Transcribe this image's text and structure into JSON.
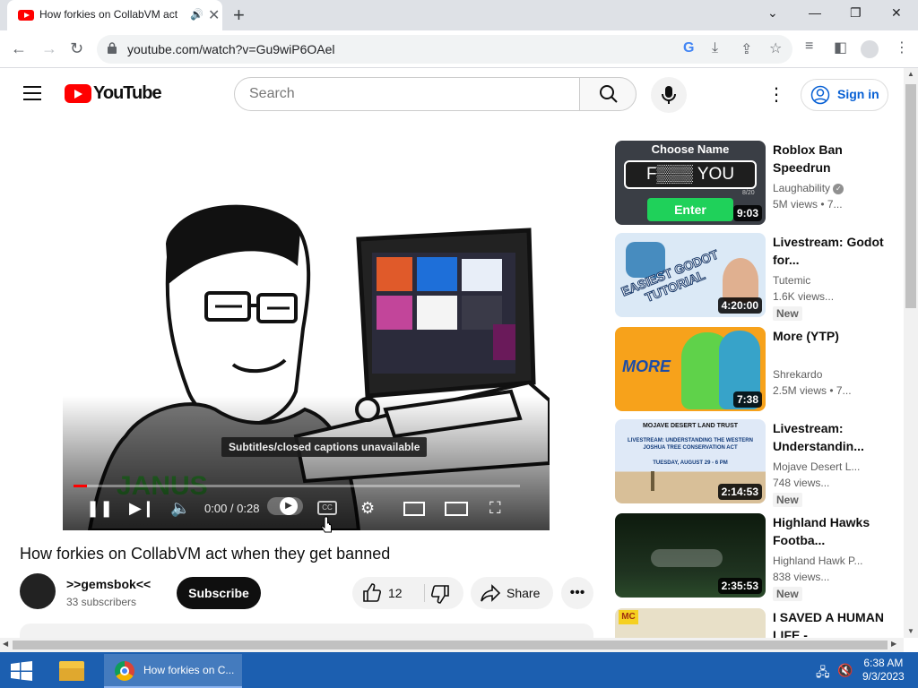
{
  "browser": {
    "tab_title": "How forkies on CollabVM act",
    "url": "youtube.com/watch?v=Gu9wiP6OAel"
  },
  "youtube": {
    "logo_text": "YouTube",
    "search_placeholder": "Search",
    "sign_in": "Sign in"
  },
  "player": {
    "tooltip": "Subtitles/closed captions unavailable",
    "time": "0:00 / 0:28",
    "progress_fraction": 0.03
  },
  "video": {
    "title": "How forkies on CollabVM act when they get banned",
    "channel": ">>gemsbok<<",
    "subscribers": "33 subscribers",
    "subscribe_label": "Subscribe",
    "likes": "12",
    "share_label": "Share"
  },
  "recommendations": [
    {
      "title": "Roblox Ban Speedrun",
      "channel": "Laughability",
      "views": "5M views  • 7...",
      "duration": "9:03",
      "badge": "",
      "verified": true,
      "thumb_text": "Choose Name",
      "thumb_field": "F▒▒▒ YOU",
      "thumb_button": "Enter",
      "thumb_counter": "8/20"
    },
    {
      "title": "Livestream: Godot for...",
      "channel": "Tutemic",
      "views": "1.6K views...",
      "duration": "4:20:00",
      "badge": "New",
      "thumb_text": "EASIEST GODOT TUTORIAL"
    },
    {
      "title": "More (YTP)",
      "channel": "Shrekardo",
      "views": "2.5M views  • 7...",
      "duration": "7:38",
      "badge": "",
      "thumb_text": "MORE"
    },
    {
      "title": "Livestream: Understandin...",
      "channel": "Mojave Desert L...",
      "views": "748 views...",
      "duration": "2:14:53",
      "badge": "New",
      "thumb_text": "MOJAVE DESERT LAND TRUST",
      "thumb_sub": "LIVESTREAM: UNDERSTANDING THE WESTERN JOSHUA TREE CONSERVATION ACT",
      "thumb_date": "TUESDAY, AUGUST 29 - 6 PM"
    },
    {
      "title": "Highland Hawks Footba...",
      "channel": "Highland Hawk P...",
      "views": "838 views...",
      "duration": "2:35:53",
      "badge": "New"
    },
    {
      "title": "I SAVED A HUMAN LIFE -",
      "channel": "",
      "views": "",
      "duration": "",
      "badge": "",
      "thumb_text": "MC"
    }
  ],
  "taskbar": {
    "chrome_label": "How forkies on C...",
    "time": "6:38 AM",
    "date": "9/3/2023"
  },
  "colors": {
    "youtube_red": "#ff0000",
    "taskbar_blue": "#1c5fb0",
    "link_blue": "#065fd4"
  }
}
